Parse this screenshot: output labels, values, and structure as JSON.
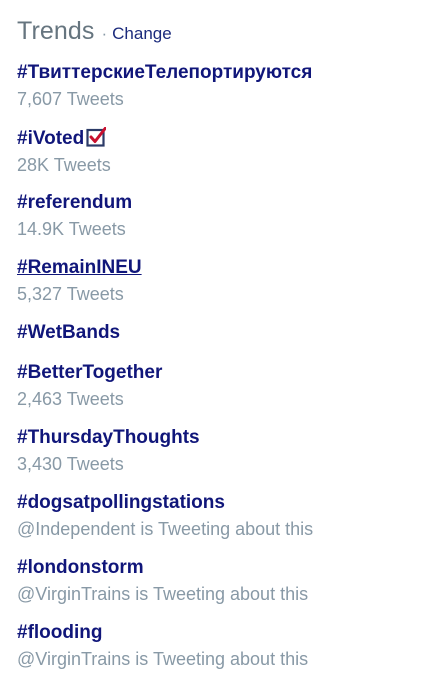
{
  "header": {
    "title": "Trends",
    "separator": "·",
    "change_label": "Change"
  },
  "trends": [
    {
      "name": "#ТвиттерскиеТелепортируются",
      "meta": "7,607 Tweets"
    },
    {
      "name": "#iVoted",
      "meta": "28K Tweets",
      "icon": "ballot-box-check-icon"
    },
    {
      "name": "#referendum",
      "meta": "14.9K Tweets"
    },
    {
      "name": "#RemainINEU",
      "meta": "5,327 Tweets",
      "underlined": true
    },
    {
      "name": "#WetBands",
      "meta": ""
    },
    {
      "name": "#BetterTogether",
      "meta": "2,463 Tweets"
    },
    {
      "name": "#ThursdayThoughts",
      "meta": "3,430 Tweets"
    },
    {
      "name": "#dogsatpollingstations",
      "meta": "@Independent is Tweeting about this"
    },
    {
      "name": "#londonstorm",
      "meta": "@VirginTrains is Tweeting about this"
    },
    {
      "name": "#flooding",
      "meta": "@VirginTrains is Tweeting about this"
    }
  ],
  "colors": {
    "trend_link": "#10167a",
    "muted_text": "#8899a6",
    "title_text": "#66757f",
    "check_red": "#c8102e",
    "box_navy": "#2b3a67"
  }
}
